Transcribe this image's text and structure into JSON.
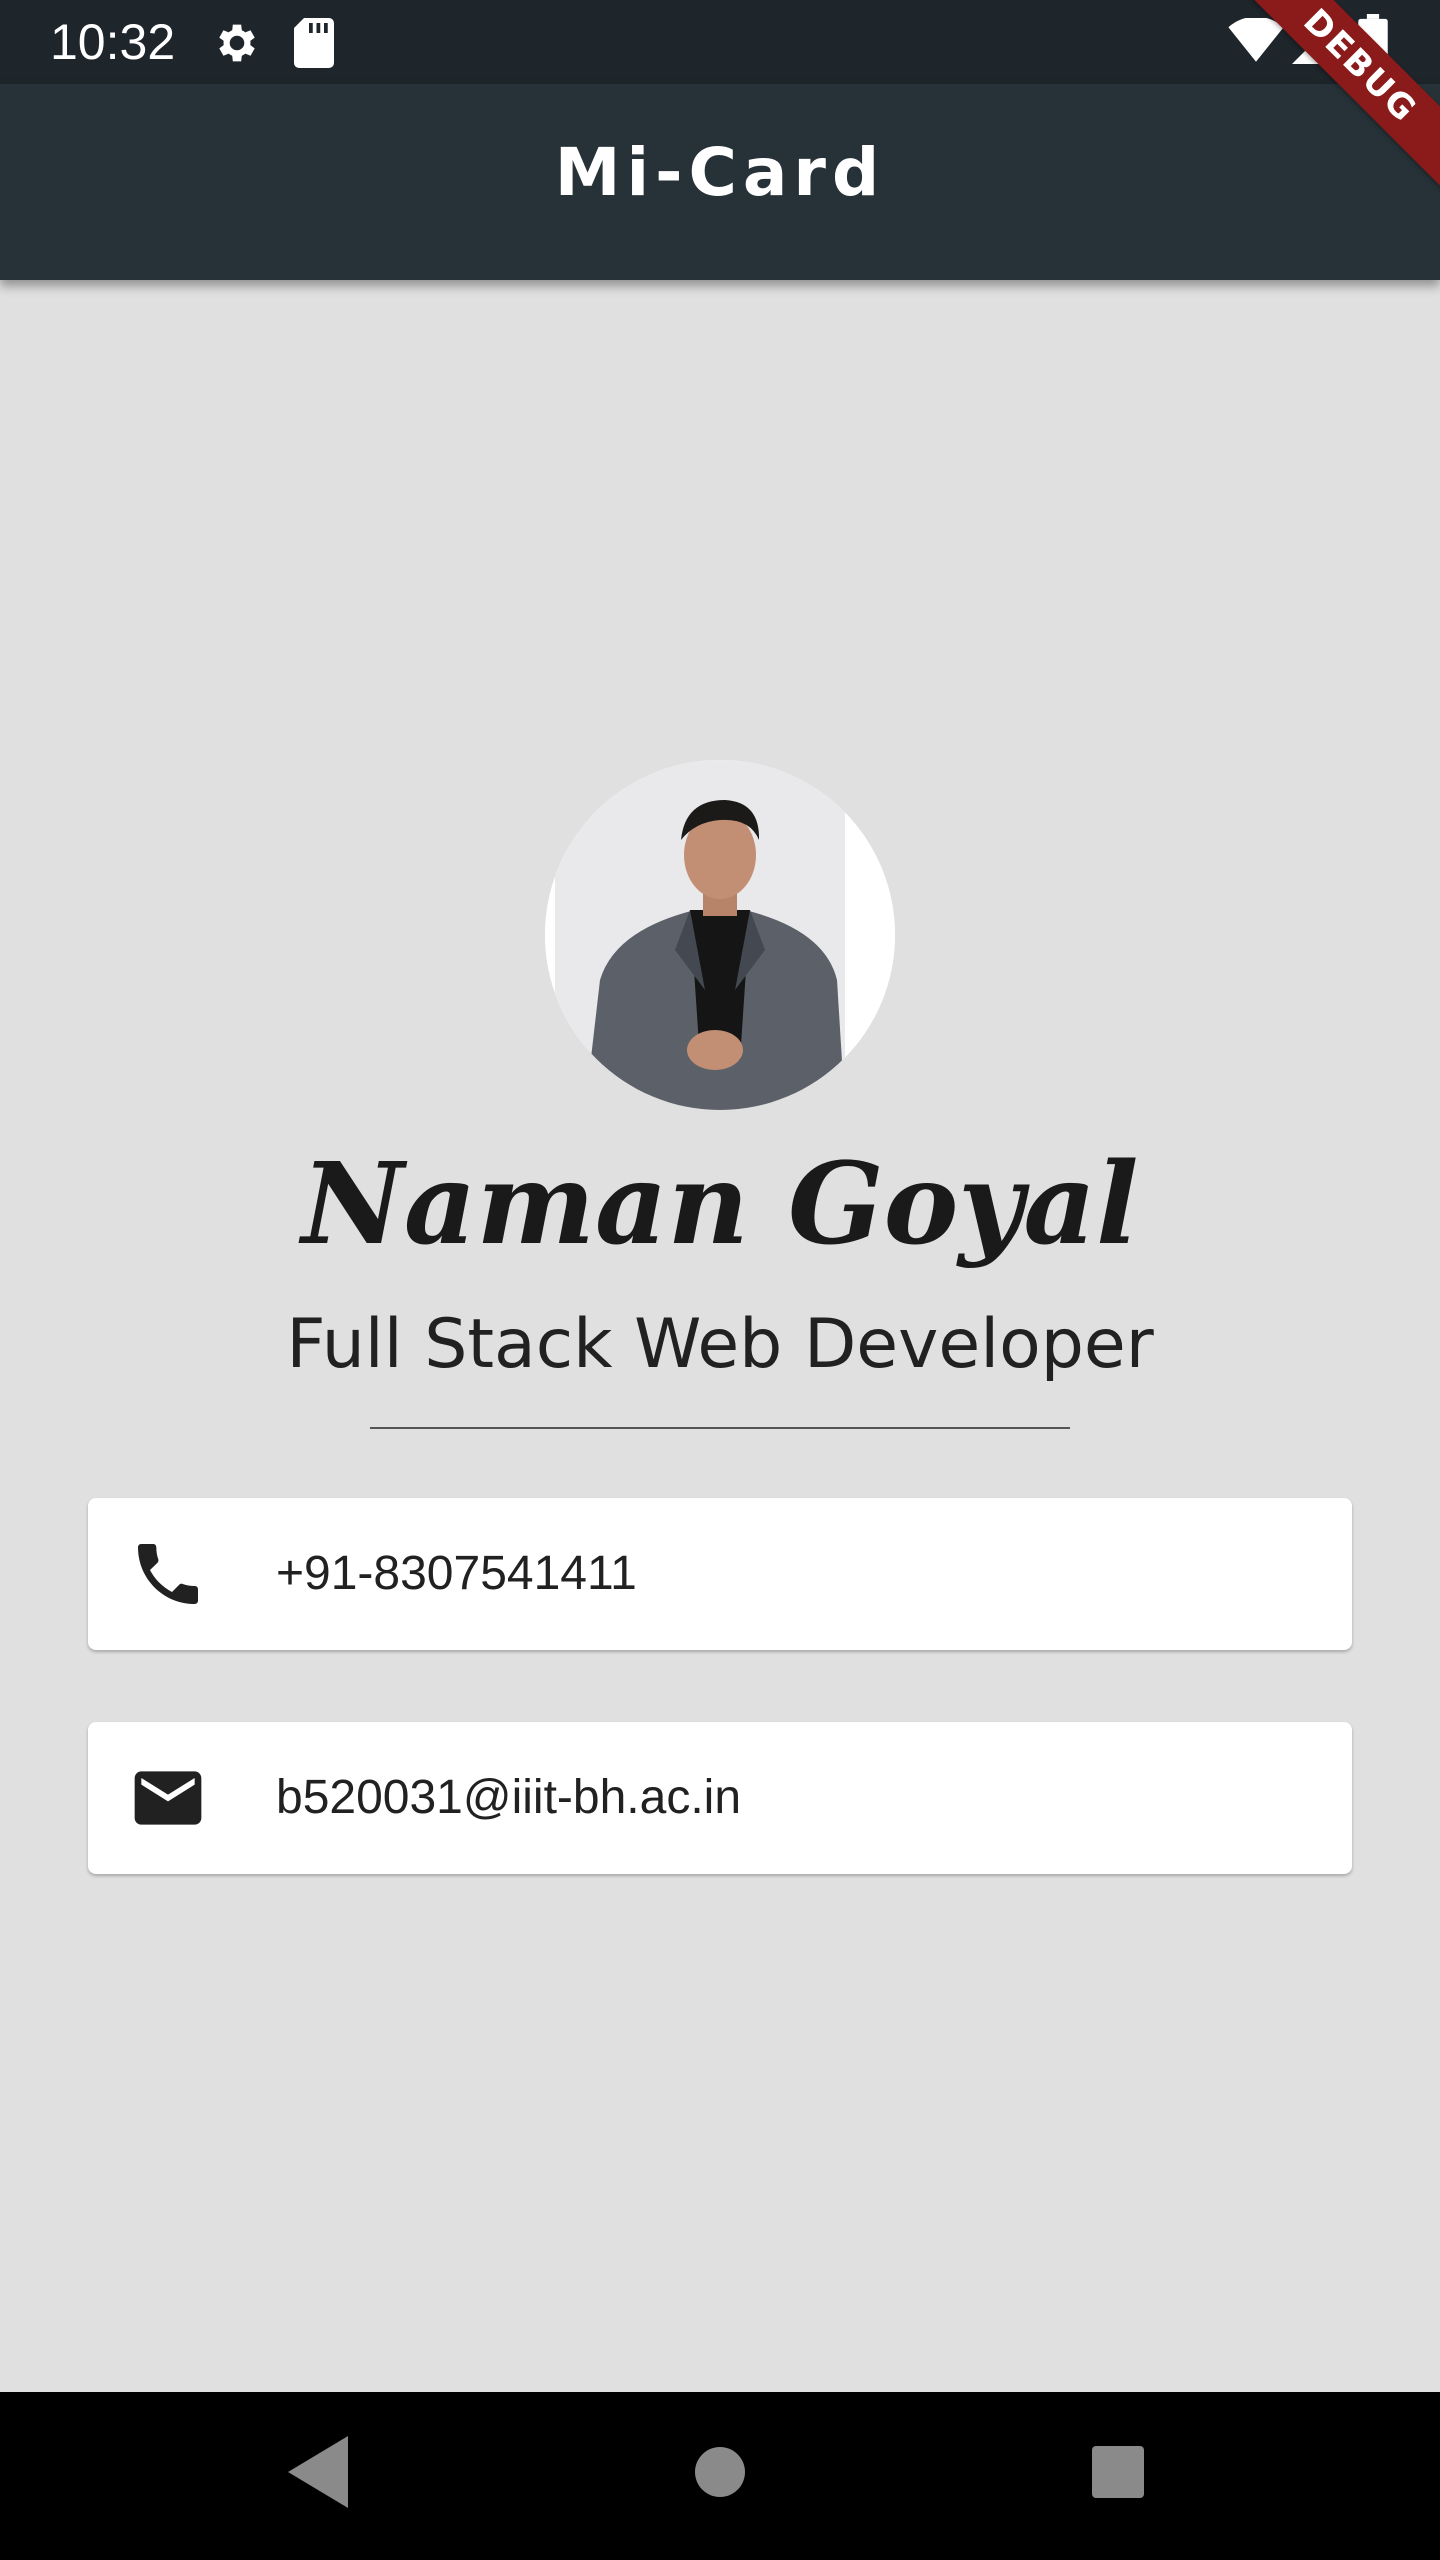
{
  "status_bar": {
    "time": "10:32",
    "icons": [
      "gear-icon",
      "sd-card-icon",
      "wifi-icon",
      "signal-icon",
      "battery-icon"
    ]
  },
  "app_bar": {
    "title": "Mi-Card"
  },
  "debug_banner": {
    "label": "DEBUG"
  },
  "profile": {
    "name": "Naman Goyal",
    "subtitle": "Full Stack Web Developer"
  },
  "contacts": {
    "phone": {
      "icon": "phone-icon",
      "value": "+91-8307541411"
    },
    "email": {
      "icon": "mail-icon",
      "value": "b520031@iiit-bh.ac.in"
    }
  },
  "nav_bar": {
    "icons": [
      "back-icon",
      "home-icon",
      "recents-icon"
    ]
  },
  "colors": {
    "app_bar": "#263238",
    "status_bar": "#1e252b",
    "background": "#e0e0e0",
    "card": "#ffffff",
    "debug_ribbon": "#8b1a1a"
  }
}
